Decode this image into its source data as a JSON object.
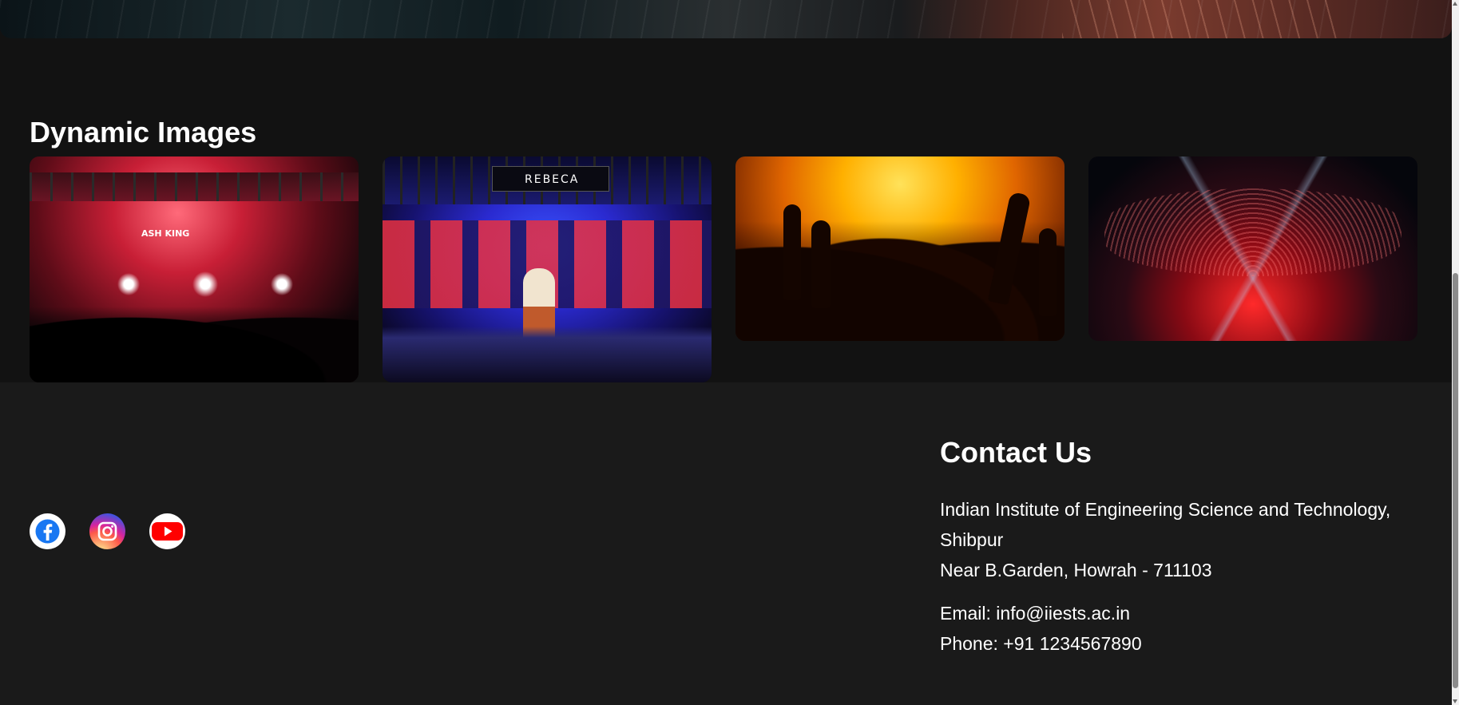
{
  "gallery": {
    "title": "Dynamic Images",
    "images": [
      {
        "name": "concert-image-1",
        "overlay_text": "ASH KING"
      },
      {
        "name": "concert-image-2",
        "overlay_text": "REBECA"
      },
      {
        "name": "concert-image-3",
        "overlay_text": ""
      },
      {
        "name": "concert-image-4",
        "overlay_text": ""
      }
    ]
  },
  "social": [
    {
      "name": "facebook-icon",
      "color": "#1877F2"
    },
    {
      "name": "instagram-icon",
      "color": "#E1306C"
    },
    {
      "name": "youtube-icon",
      "color": "#FF0000"
    }
  ],
  "contact": {
    "title": "Contact Us",
    "address_line1": "Indian Institute of Engineering Science and Technology,",
    "address_line2": "Shibpur",
    "address_line3": "Near B.Garden, Howrah - 711103",
    "email": "Email: info@iiests.ac.in",
    "phone": "Phone: +91 1234567890"
  },
  "colors": {
    "page_bg": "#121212",
    "footer_bg": "#1a1a1a",
    "text": "#ffffff"
  }
}
